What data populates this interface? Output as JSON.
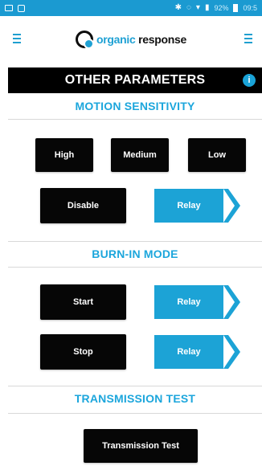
{
  "status_bar": {
    "battery_pct": "92%",
    "time": "09:5"
  },
  "app": {
    "logo_primary": "organic",
    "logo_secondary": "response"
  },
  "title": "OTHER PARAMETERS",
  "info_glyph": "i",
  "motion_sensitivity": {
    "heading": "MOTION SENSITIVITY",
    "buttons": [
      "High",
      "Medium",
      "Low"
    ],
    "disable_label": "Disable",
    "relay_label": "Relay"
  },
  "burn_in": {
    "heading": "BURN-IN MODE",
    "start_label": "Start",
    "stop_label": "Stop",
    "relay_label": "Relay"
  },
  "transmission": {
    "heading": "TRANSMISSION TEST",
    "button_label": "Transmission Test"
  },
  "colors": {
    "accent": "#1ca3d6",
    "button": "#060606"
  },
  "icons": [
    "menu-icon",
    "info-icon",
    "bluetooth-icon",
    "vibrate-icon",
    "wifi-icon",
    "signal-icon",
    "battery-icon",
    "chevron-right-icon"
  ]
}
